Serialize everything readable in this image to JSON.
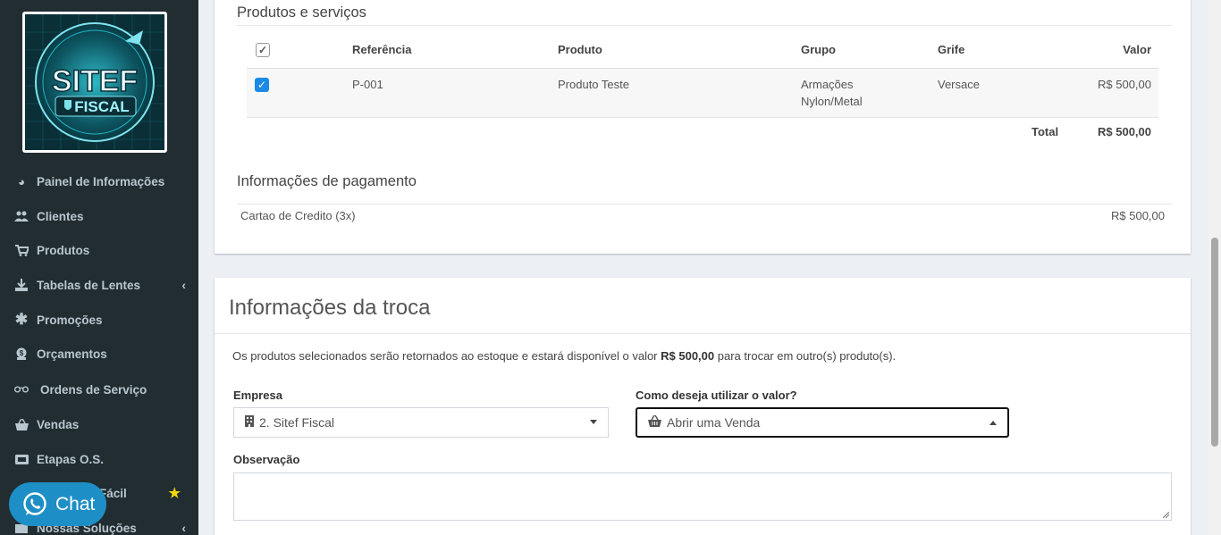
{
  "sidebar": {
    "logo_text": "SITEF FISCAL",
    "items": [
      {
        "label": "Painel de Informações",
        "icon": "dashboard-icon"
      },
      {
        "label": "Clientes",
        "icon": "users-icon"
      },
      {
        "label": "Produtos",
        "icon": "cart-icon"
      },
      {
        "label": "Tabelas de Lentes",
        "icon": "download-icon",
        "chevron": "‹"
      },
      {
        "label": "Promoções",
        "icon": "asterisk-icon"
      },
      {
        "label": "Orçamentos",
        "icon": "budget-icon"
      },
      {
        "label": "Ordens de Serviço",
        "icon": "glasses-icon"
      },
      {
        "label": "Vendas",
        "icon": "basket-icon"
      },
      {
        "label": "Etapas O.S.",
        "icon": "ticket-icon"
      },
      {
        "label": "Fácil",
        "icon": "star-icon"
      },
      {
        "label": "Nossas Soluções",
        "icon": "solutions-icon",
        "chevron": "‹"
      }
    ]
  },
  "chat": {
    "label": "Chat"
  },
  "products": {
    "title": "Produtos e serviços",
    "columns": [
      "Referência",
      "Produto",
      "Grupo",
      "Grife",
      "Valor"
    ],
    "rows": [
      {
        "ref": "P-001",
        "produto": "Produto Teste",
        "grupo_1": "Armações",
        "grupo_2": "Nylon/Metal",
        "grife": "Versace",
        "valor": "R$ 500,00",
        "checked": true
      }
    ],
    "total_label": "Total",
    "total_value": "R$ 500,00"
  },
  "payment": {
    "title": "Informações de pagamento",
    "method": "Cartao de Credito (3x)",
    "value": "R$ 500,00"
  },
  "exchange": {
    "title": "Informações da troca",
    "text_before": "Os produtos selecionados serão retornados ao estoque e estará disponível o valor",
    "amount": "R$ 500,00",
    "text_after": "para trocar em outro(s) produto(s).",
    "empresa_label": "Empresa",
    "empresa_value": "2. Sitef Fiscal",
    "uso_label": "Como deseja utilizar o valor?",
    "uso_value": "Abrir uma Venda",
    "obs_label": "Observação"
  },
  "colors": {
    "sidebar_bg": "#222d32",
    "accent": "#1a8ae5",
    "chat": "#1e8fc6",
    "star": "#f5d90a"
  }
}
